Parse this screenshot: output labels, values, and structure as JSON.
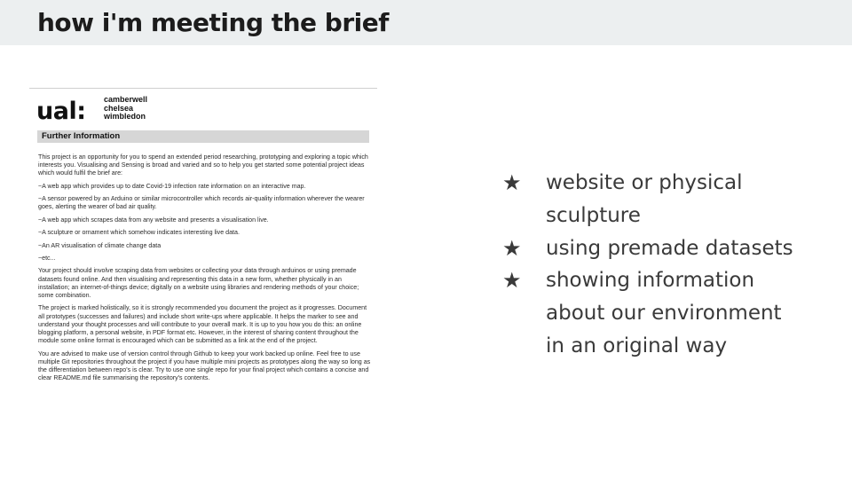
{
  "slide": {
    "title": "how i'm meeting the brief"
  },
  "document": {
    "logo": {
      "mark": "ual:",
      "colleges": [
        "camberwell",
        "chelsea",
        "wimbledon"
      ]
    },
    "section_heading": "Further Information",
    "paragraphs": [
      "This project is an opportunity for you to spend an extended period researching, prototyping and exploring a topic which interests you. Visualising and Sensing is broad and varied and so to help you get started some potential project ideas which would fulfil the brief are:",
      "~A web app which provides up to date Covid-19 infection rate information on an interactive map.",
      "~A sensor powered by an Arduino or similar microcontroller which records air-quality information wherever the wearer goes, alerting the wearer of bad air quality.",
      "~A web app which scrapes data from any website and presents a visualisation live.",
      "~A sculpture or ornament which somehow indicates interesting live data.",
      "~An AR visualisation of climate change data",
      "~etc...",
      "Your project should involve scraping data from websites or collecting your data through arduinos or using premade datasets found online. And then visualising and representing this data in a new form, whether physically in an installation; an internet-of-things device; digitally on a website using libraries and rendering methods of your choice; some combination.",
      "The project is marked holistically, so it is strongly recommended you document the project as it progresses. Document all prototypes (successes and failures) and include short write-ups where applicable. It helps the marker to see and understand your thought processes and will contribute to your overall mark. It is up to you how you do this: an online blogging platform, a personal website, in PDF format etc. However, in the interest of sharing content throughout the module some online format is encouraged which can be submitted as a link at the end of the project.",
      "You are advised to make use of version control through Github to keep your work backed up online. Feel free to use multiple Git repositories throughout the project if you have multiple mini projects as prototypes along the way so long as the differentiation between repo's is clear. Try to use one single repo for your final project which contains a concise and clear README.md file summarising the repository's contents."
    ]
  },
  "bullets": {
    "icon": "star-icon",
    "items": [
      {
        "line1": "website or physical",
        "line2": "sculpture",
        "line3": ""
      },
      {
        "line1": "using premade datasets",
        "line2": "",
        "line3": ""
      },
      {
        "line1": "showing information",
        "line2": "about our environment",
        "line3": "in an original way"
      }
    ]
  }
}
